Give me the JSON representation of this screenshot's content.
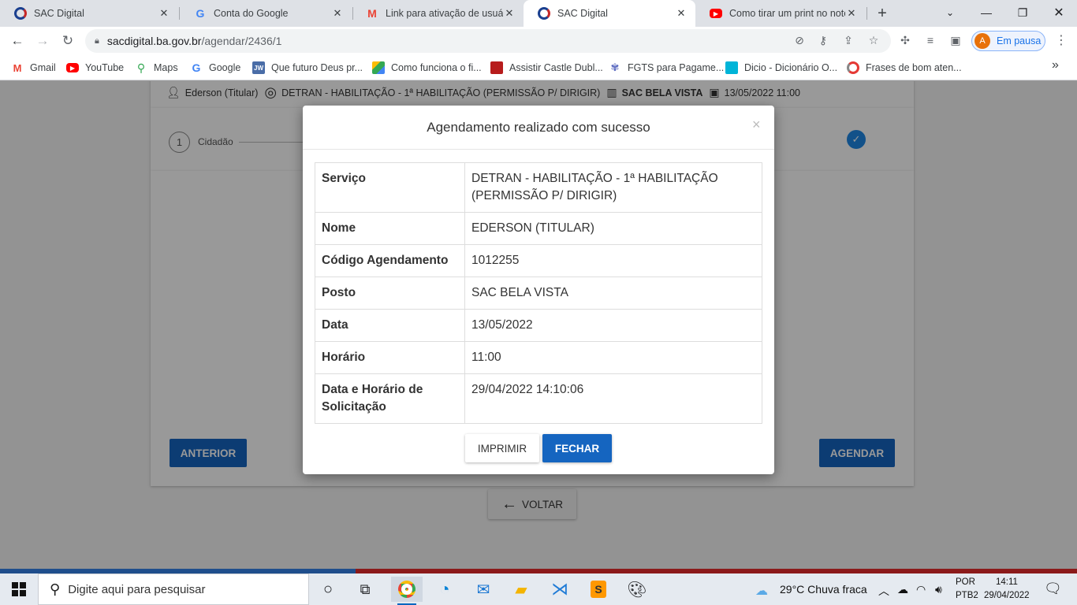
{
  "browser": {
    "tabs": [
      {
        "title": "SAC Digital",
        "icon": "sac-icon",
        "active": false
      },
      {
        "title": "Conta do Google",
        "icon": "google-icon",
        "active": false
      },
      {
        "title": "Link para ativação de usuário",
        "icon": "gmail-icon",
        "active": false
      },
      {
        "title": "SAC Digital",
        "icon": "sac-icon",
        "active": true
      },
      {
        "title": "Como tirar um print no notebook",
        "icon": "youtube-icon",
        "active": false
      }
    ],
    "url_host": "sacdigital.ba.gov.br",
    "url_path": "/agendar/2436/1",
    "profile_initial": "A",
    "profile_status": "Em pausa",
    "bookmarks": [
      {
        "label": "Gmail",
        "icon": "gmail-icon"
      },
      {
        "label": "YouTube",
        "icon": "youtube-icon"
      },
      {
        "label": "Maps",
        "icon": "maps-icon"
      },
      {
        "label": "Google",
        "icon": "google-icon"
      },
      {
        "label": "Que futuro Deus pr...",
        "icon": "jw-icon",
        "icon_text": "JW"
      },
      {
        "label": "Como funciona o fi...",
        "icon": "drive-icon"
      },
      {
        "label": "Assistir Castle Dubl...",
        "icon": "castle-icon"
      },
      {
        "label": "FGTS para Pagame...",
        "icon": "fgts-icon"
      },
      {
        "label": "Dicio - Dicionário O...",
        "icon": "dicio-icon"
      },
      {
        "label": "Frases de bom aten...",
        "icon": "frases-icon"
      }
    ]
  },
  "page": {
    "summary": {
      "person": "Ederson (Titular)",
      "service": "DETRAN - HABILITAÇÃO - 1ª HABILITAÇÃO (PERMISSÃO P/ DIRIGIR)",
      "location": "SAC BELA VISTA",
      "datetime": "13/05/2022 11:00"
    },
    "step": {
      "number": "1",
      "label": "Cidadão"
    },
    "anterior_label": "ANTERIOR",
    "agendar_label": "AGENDAR",
    "voltar_label": "VOLTAR"
  },
  "modal": {
    "title": "Agendamento realizado com sucesso",
    "close_symbol": "×",
    "rows": [
      {
        "key": "Serviço",
        "value": "DETRAN - HABILITAÇÃO - 1ª HABILITAÇÃO (PERMISSÃO P/ DIRIGIR)"
      },
      {
        "key": "Nome",
        "value": "EDERSON (TITULAR)"
      },
      {
        "key": "Código Agendamento",
        "value": "1012255"
      },
      {
        "key": "Posto",
        "value": "SAC BELA VISTA"
      },
      {
        "key": "Data",
        "value": "13/05/2022"
      },
      {
        "key": "Horário",
        "value": "11:00"
      },
      {
        "key": "Data e Horário de Solicitação",
        "value": "29/04/2022 14:10:06"
      }
    ],
    "print_label": "IMPRIMIR",
    "close_label": "FECHAR"
  },
  "taskbar": {
    "search_placeholder": "Digite aqui para pesquisar",
    "weather": "29°C  Chuva fraca",
    "lang_top": "POR",
    "lang_bottom": "PTB2",
    "time": "14:11",
    "date": "29/04/2022"
  },
  "colors": {
    "primary_button": "#1565c0",
    "overlay": "rgba(0,0,0,0.4)"
  }
}
